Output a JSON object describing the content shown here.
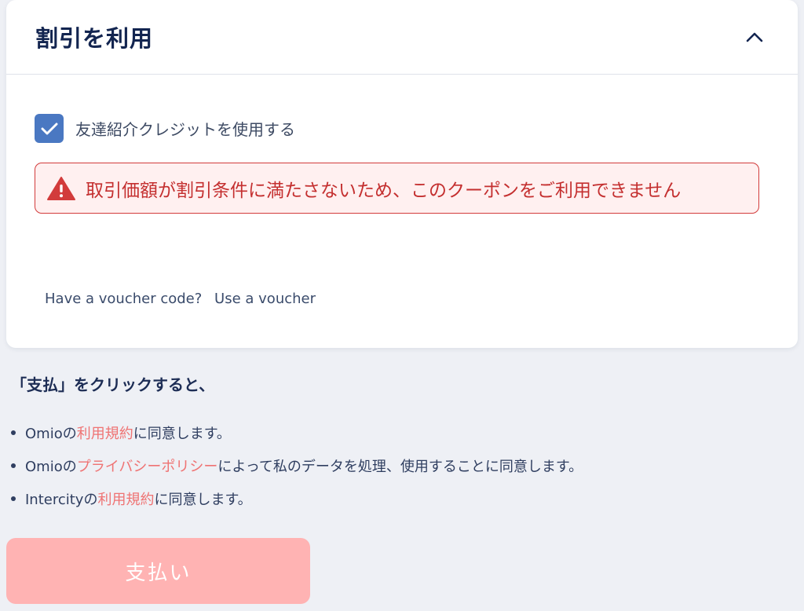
{
  "discount_card": {
    "title": "割引を利用",
    "checkbox_label": "友達紹介クレジットを使用する",
    "alert_text": "取引価額が割引条件に満たさないため、このクーポンをご利用できません",
    "voucher_prompt": "Have a voucher code?",
    "voucher_link": "Use a voucher"
  },
  "terms": {
    "title": "「支払」をクリックすると、",
    "items": [
      {
        "pre": "Omioの",
        "link": "利用規約",
        "post": "に同意します。"
      },
      {
        "pre": "Omioの",
        "link": "プライバシーポリシー",
        "post": "によって私のデータを処理、使用することに同意します。"
      },
      {
        "pre": "Intercityの ",
        "link": "利用規約",
        "post": "に同意します。"
      }
    ]
  },
  "pay_button": {
    "label": "支払い"
  },
  "colors": {
    "accent": "#4a78c2",
    "error": "#c42f2f",
    "link": "#ef7373",
    "button_disabled": "#ffb3b3"
  },
  "icons": {
    "collapse": "chevron-up-icon",
    "checkbox": "check-icon",
    "alert": "warning-icon"
  }
}
